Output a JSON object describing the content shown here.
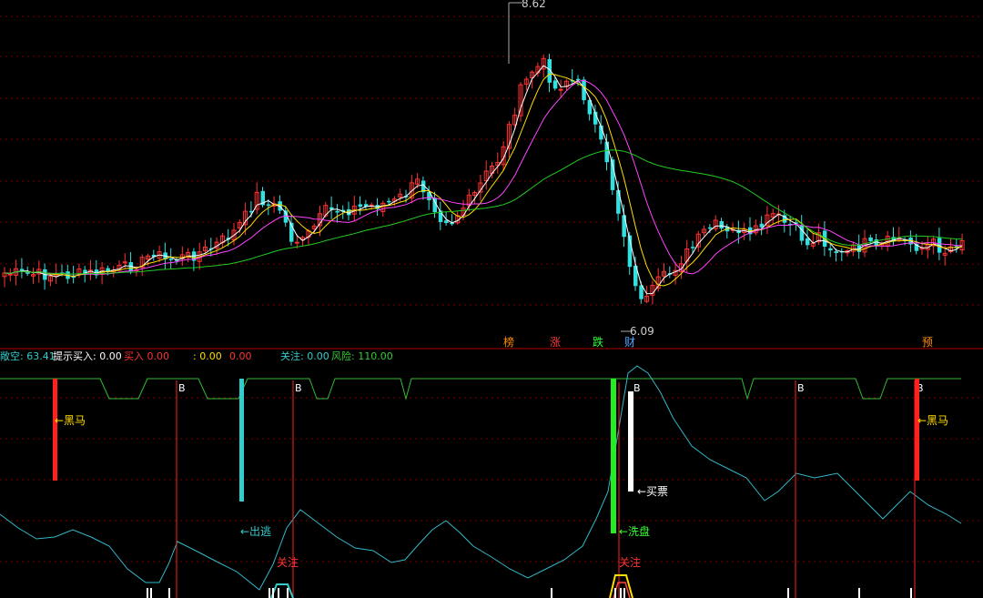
{
  "chart_data": [
    {
      "type": "candlestick",
      "panel": "main",
      "high_label": "8.62",
      "low_label": "6.09",
      "event_markers": [
        {
          "text": "榜",
          "color": "#ff8c00"
        },
        {
          "text": "涨",
          "color": "#ff3333"
        },
        {
          "text": "跌",
          "color": "#33ff33"
        },
        {
          "text": "财",
          "color": "#4fa8ff"
        },
        {
          "text": "预",
          "color": "#ff8c00"
        }
      ],
      "colors": {
        "up": "#ff3333",
        "down": "#33e0e0",
        "ma1": "#ffffff",
        "ma2": "#ffdd00",
        "ma3": "#ff44ff",
        "ma4": "#22cc22"
      }
    },
    {
      "type": "indicator",
      "panel": "sub",
      "labels": [
        {
          "name": "多空",
          "display": "敞空:",
          "value": "63.41",
          "color": "#33cccc"
        },
        {
          "name": "提示买入",
          "display": "提示买入:",
          "value": "0.00",
          "color": "#ffffff"
        },
        {
          "name": "买入",
          "display": "买入",
          "value": "0.00",
          "color": "#ff3333"
        },
        {
          "name": "",
          "display": ":",
          "value": "0.00",
          "color": "#ffdd00"
        },
        {
          "name": "",
          "display": "",
          "value": "0.00",
          "color": "#ff3333"
        },
        {
          "name": "关注",
          "display": "关注:",
          "value": "0.00",
          "color": "#33cccc"
        },
        {
          "name": "风险",
          "display": "风险:",
          "value": "110.00",
          "color": "#33cc33"
        }
      ],
      "annotations": [
        {
          "text": "←黑马",
          "color": "#ffdd00"
        },
        {
          "text": "←出逃",
          "color": "#33cccc"
        },
        {
          "text": "关注",
          "color": "#ff3333"
        },
        {
          "text": "←买票",
          "color": "#ffffff"
        },
        {
          "text": "←洗盘",
          "color": "#33ff33"
        },
        {
          "text": "关注",
          "color": "#ff3333"
        },
        {
          "text": "←黑马",
          "color": "#ffdd00"
        }
      ],
      "b_marker": "B"
    }
  ]
}
